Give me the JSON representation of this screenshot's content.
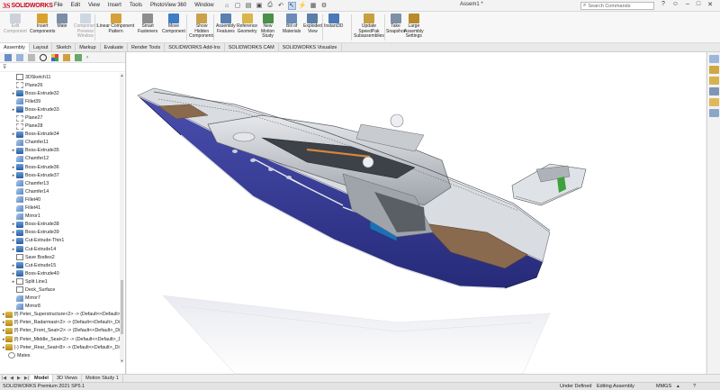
{
  "app": {
    "logo_ds": "3S",
    "logo_text": "SOLIDWORKS",
    "document_title": "Assem1 *",
    "search_placeholder": "Search Commands"
  },
  "menu": [
    "File",
    "Edit",
    "View",
    "Insert",
    "Tools",
    "PhotoView 360",
    "Window"
  ],
  "ribbon": [
    {
      "label": "Edit\nComponent",
      "disabled": true,
      "color": "#9aa3b5",
      "icon": "edit-component-icon"
    },
    {
      "label": "Insert\nComponents",
      "disabled": false,
      "color": "#d9a230",
      "icon": "insert-components-icon"
    },
    {
      "label": "Mate",
      "disabled": false,
      "color": "#7b8ea8",
      "icon": "mate-icon"
    },
    {
      "label": "Component\nPreview\nWindow",
      "disabled": true,
      "color": "#9bb0c8",
      "icon": "component-preview-icon"
    },
    {
      "label": "Linear Component\nPattern",
      "disabled": false,
      "color": "#d4a13a",
      "icon": "linear-pattern-icon"
    },
    {
      "label": "Smart\nFasteners",
      "disabled": false,
      "color": "#8d8d8d",
      "icon": "smart-fasteners-icon"
    },
    {
      "label": "Move\nComponent",
      "disabled": false,
      "color": "#3f7dc4",
      "icon": "move-component-icon"
    },
    {
      "label": "Show\nHidden\nComponents",
      "disabled": false,
      "color": "#c9a24a",
      "icon": "show-hidden-icon"
    },
    {
      "label": "Assembly\nFeatures",
      "disabled": false,
      "color": "#5a7fb0",
      "icon": "assembly-features-icon"
    },
    {
      "label": "Reference\nGeometry",
      "disabled": false,
      "color": "#d9b64a",
      "icon": "reference-geometry-icon"
    },
    {
      "label": "New\nMotion\nStudy",
      "disabled": false,
      "color": "#4a8f4a",
      "icon": "motion-study-icon"
    },
    {
      "label": "Bill of\nMaterials",
      "disabled": false,
      "color": "#6a8ab8",
      "icon": "bom-icon"
    },
    {
      "label": "Exploded\nView",
      "disabled": false,
      "color": "#5c7fa8",
      "icon": "exploded-view-icon"
    },
    {
      "label": "Instant3D",
      "disabled": false,
      "color": "#4a78b8",
      "icon": "instant3d-icon"
    },
    {
      "label": "Update\nSpeedPak\nSubassemblies",
      "disabled": false,
      "color": "#c8a040",
      "icon": "speedpak-icon"
    },
    {
      "label": "Take\nSnapshot",
      "disabled": false,
      "color": "#7f8fa6",
      "icon": "snapshot-icon"
    },
    {
      "label": "Large\nAssembly\nSettings",
      "disabled": false,
      "color": "#b88a2a",
      "icon": "large-assembly-icon"
    }
  ],
  "tabs": [
    "Assembly",
    "Layout",
    "Sketch",
    "Markup",
    "Evaluate",
    "Render Tools",
    "SOLIDWORKS Add-Ins",
    "SOLIDWORKS CAM",
    "SOLIDWORKS Visualize"
  ],
  "active_tab": "Assembly",
  "tree": [
    {
      "label": "3DSketch11",
      "icon": "sketch",
      "expand": false
    },
    {
      "label": "Plane26",
      "icon": "plane",
      "expand": false
    },
    {
      "label": "Boss-Extrude32",
      "icon": "feat",
      "expand": true
    },
    {
      "label": "Fillet39",
      "icon": "fillet",
      "expand": false
    },
    {
      "label": "Boss-Extrude33",
      "icon": "feat",
      "expand": true
    },
    {
      "label": "Plane27",
      "icon": "plane",
      "expand": false
    },
    {
      "label": "Plane28",
      "icon": "plane",
      "expand": false
    },
    {
      "label": "Boss-Extrude34",
      "icon": "feat",
      "expand": true
    },
    {
      "label": "Chamfer11",
      "icon": "fillet",
      "expand": false
    },
    {
      "label": "Boss-Extrude35",
      "icon": "feat",
      "expand": true
    },
    {
      "label": "Chamfer12",
      "icon": "fillet",
      "expand": false
    },
    {
      "label": "Boss-Extrude36",
      "icon": "feat",
      "expand": true
    },
    {
      "label": "Boss-Extrude37",
      "icon": "feat",
      "expand": true
    },
    {
      "label": "Chamfer13",
      "icon": "fillet",
      "expand": false
    },
    {
      "label": "Chamfer14",
      "icon": "fillet",
      "expand": false
    },
    {
      "label": "Fillet40",
      "icon": "fillet",
      "expand": false
    },
    {
      "label": "Fillet41",
      "icon": "fillet",
      "expand": false
    },
    {
      "label": "Mirror1",
      "icon": "fillet",
      "expand": false
    },
    {
      "label": "Boss-Extrude38",
      "icon": "feat",
      "expand": true
    },
    {
      "label": "Boss-Extrude39",
      "icon": "feat",
      "expand": true
    },
    {
      "label": "Cut-Extrude-Thin1",
      "icon": "feat",
      "expand": true
    },
    {
      "label": "Cut-Extrude14",
      "icon": "feat",
      "expand": true
    },
    {
      "label": "Save Bodies2",
      "icon": "sketch",
      "expand": false
    },
    {
      "label": "Cut-Extrude15",
      "icon": "feat",
      "expand": true
    },
    {
      "label": "Boss-Extrude40",
      "icon": "feat",
      "expand": true
    },
    {
      "label": "Split Line1",
      "icon": "sketch",
      "expand": true
    },
    {
      "label": "Deck_Surface",
      "icon": "sketch",
      "expand": false
    },
    {
      "label": "Mirror7",
      "icon": "fillet",
      "expand": false
    },
    {
      "label": "Mirror8",
      "icon": "fillet",
      "expand": false
    },
    {
      "label": "(f) Peter_Superstructure<2> -> (Default<<Default>_",
      "icon": "part",
      "expand": true
    },
    {
      "label": "(f) Peter_Radarmast<2> -> (Default<<Default>_Disp",
      "icon": "part",
      "expand": true
    },
    {
      "label": "(f) Peter_Front_Seat<2> -> (Default<<Default>_Disp",
      "icon": "part",
      "expand": true
    },
    {
      "label": "(f) Peter_Middle_Seat<2> -> (Default<<Default>_D",
      "icon": "part",
      "expand": true
    },
    {
      "label": "(-) Peter_Rear_Seat<8> -> (Default<<Default>_Disp",
      "icon": "part",
      "expand": true
    },
    {
      "label": "Mates",
      "icon": "mates",
      "expand": false
    }
  ],
  "bottom_tabs": [
    "Model",
    "3D Views",
    "Motion Study 1"
  ],
  "active_bottom_tab": "Model",
  "status": {
    "version": "SOLIDWORKS Premium 2021 SP5.1",
    "definition": "Under Defined",
    "mode": "Editing Assembly",
    "units": "MMGS"
  },
  "colors": {
    "hull_blue": "#3b3f9a",
    "superstructure": "#c9cdd2",
    "deck_wood": "#8a6a4e",
    "accent_green": "#3da23d",
    "brand_red": "#d0021b"
  }
}
